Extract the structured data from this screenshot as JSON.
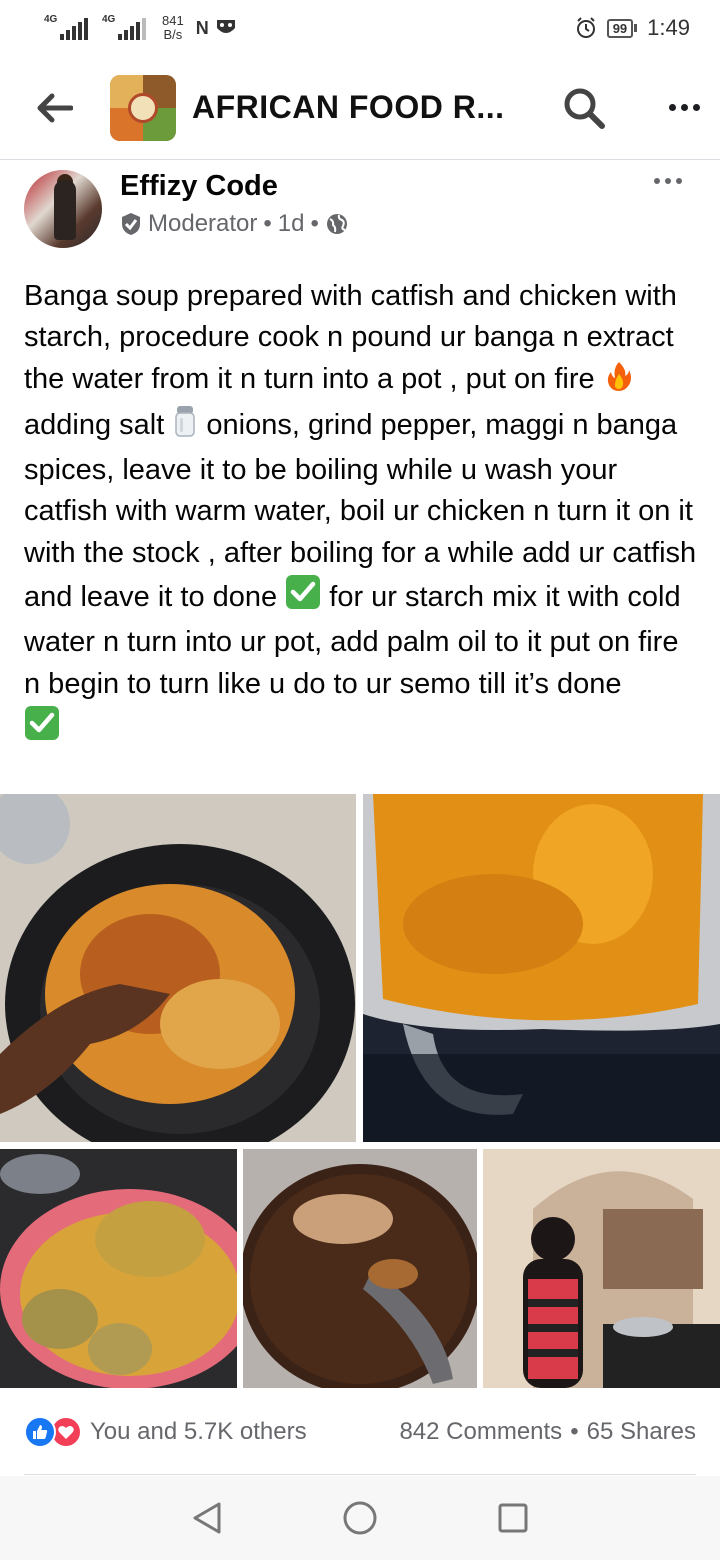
{
  "status_bar": {
    "signal1": "4G",
    "signal2": "4G",
    "net_speed_value": "841",
    "net_speed_unit": "B/s",
    "app_glyph": "N",
    "battery": "99",
    "time": "1:49"
  },
  "header": {
    "title": "AFRICAN FOOD R..."
  },
  "post": {
    "author": "Effizy Code",
    "role": "Moderator",
    "time": "1d",
    "text_parts": {
      "p1": "Banga soup prepared with catfish and chicken with starch, procedure cook n pound ur banga n extract the water from it n turn into a pot , put on fire ",
      "fire_emoji": "🔥",
      "p2": " adding salt ",
      "salt_emoji": "🧂",
      "p3": " onions, grind pepper, maggi n banga spices, leave it to be boiling while u wash your catfish with warm water, boil ur chicken n turn it on it with the stock , after boiling for a while add ur catfish and leave it to done ",
      "check_emoji": "✅",
      "p4": " for ur starch mix it with cold water n turn into ur pot, add palm oil to it put on fire n begin to turn like u do to ur semo till it’s done "
    },
    "reactions_text": "You and 5.7K others",
    "comments": "842 Comments",
    "separator": "•",
    "shares": "65 Shares"
  },
  "colors": {
    "facebook_blue": "#1877f2",
    "love_red": "#f33e58",
    "secondary_text": "#65676b"
  },
  "icons": [
    "back-arrow-icon",
    "search-icon",
    "more-icon",
    "moderator-badge-icon",
    "globe-icon",
    "like-icon",
    "love-icon",
    "nav-back-icon",
    "nav-home-icon",
    "nav-recents-icon"
  ]
}
